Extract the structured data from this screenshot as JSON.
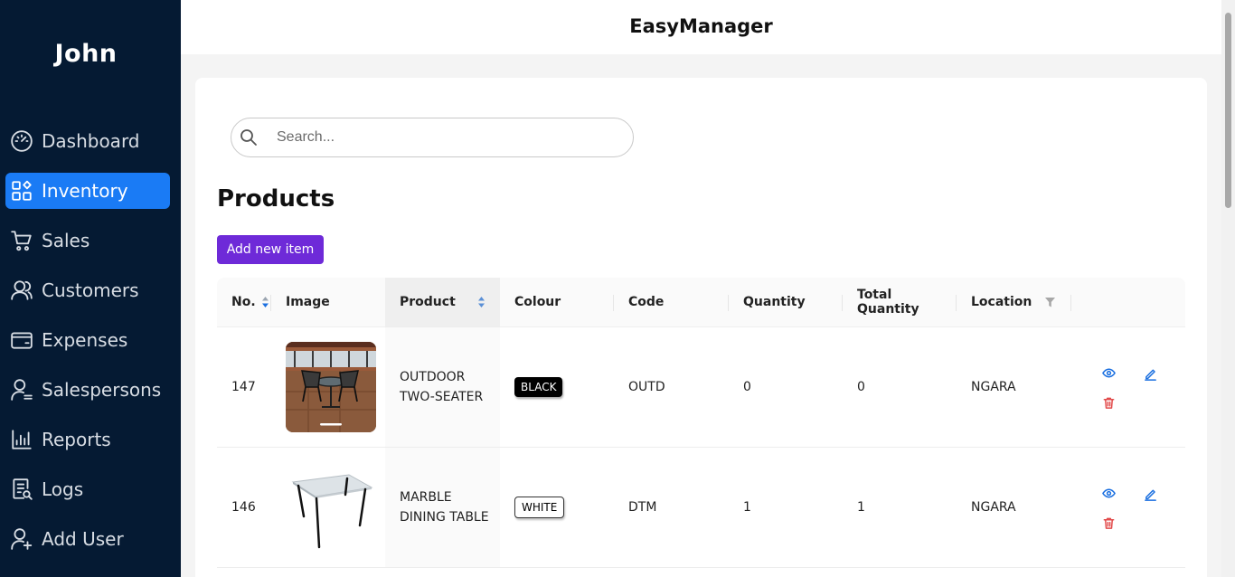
{
  "app": {
    "title": "EasyManager"
  },
  "sidebar": {
    "user_name": "John",
    "items": [
      {
        "label": "Dashboard",
        "icon": "gauge-icon",
        "active": false
      },
      {
        "label": "Inventory",
        "icon": "grid-icon",
        "active": true
      },
      {
        "label": "Sales",
        "icon": "cart-icon",
        "active": false
      },
      {
        "label": "Customers",
        "icon": "users-icon",
        "active": false
      },
      {
        "label": "Expenses",
        "icon": "wallet-icon",
        "active": false
      },
      {
        "label": "Salespersons",
        "icon": "user-gear-icon",
        "active": false
      },
      {
        "label": "Reports",
        "icon": "bar-chart-icon",
        "active": false
      },
      {
        "label": "Logs",
        "icon": "log-file-icon",
        "active": false
      },
      {
        "label": "Add User",
        "icon": "user-plus-icon",
        "active": false
      }
    ]
  },
  "search": {
    "placeholder": "Search...",
    "value": ""
  },
  "main": {
    "title": "Products",
    "add_button": "Add new item"
  },
  "table": {
    "columns": [
      "No.",
      "Image",
      "Product",
      "Colour",
      "Code",
      "Quantity",
      "Total Quantity",
      "Location"
    ],
    "rows": [
      {
        "no": "147",
        "image": "outdoor-two-seater-photo",
        "product": "OUTDOOR\nTWO-SEATER",
        "colour": "BLACK",
        "code": "OUTD",
        "quantity": "0",
        "total_quantity": "0",
        "location": "NGARA"
      },
      {
        "no": "146",
        "image": "marble-dining-table-photo",
        "product": "MARBLE\nDINING TABLE",
        "colour": "WHITE",
        "code": "DTM",
        "quantity": "1",
        "total_quantity": "1",
        "location": "NGARA"
      }
    ]
  },
  "colors": {
    "sidebar_bg": "#051a33",
    "active_nav": "#1a7bf5",
    "add_button": "#6e2ad8",
    "action_blue": "#1a6fe0",
    "action_red": "#e24b4b"
  }
}
